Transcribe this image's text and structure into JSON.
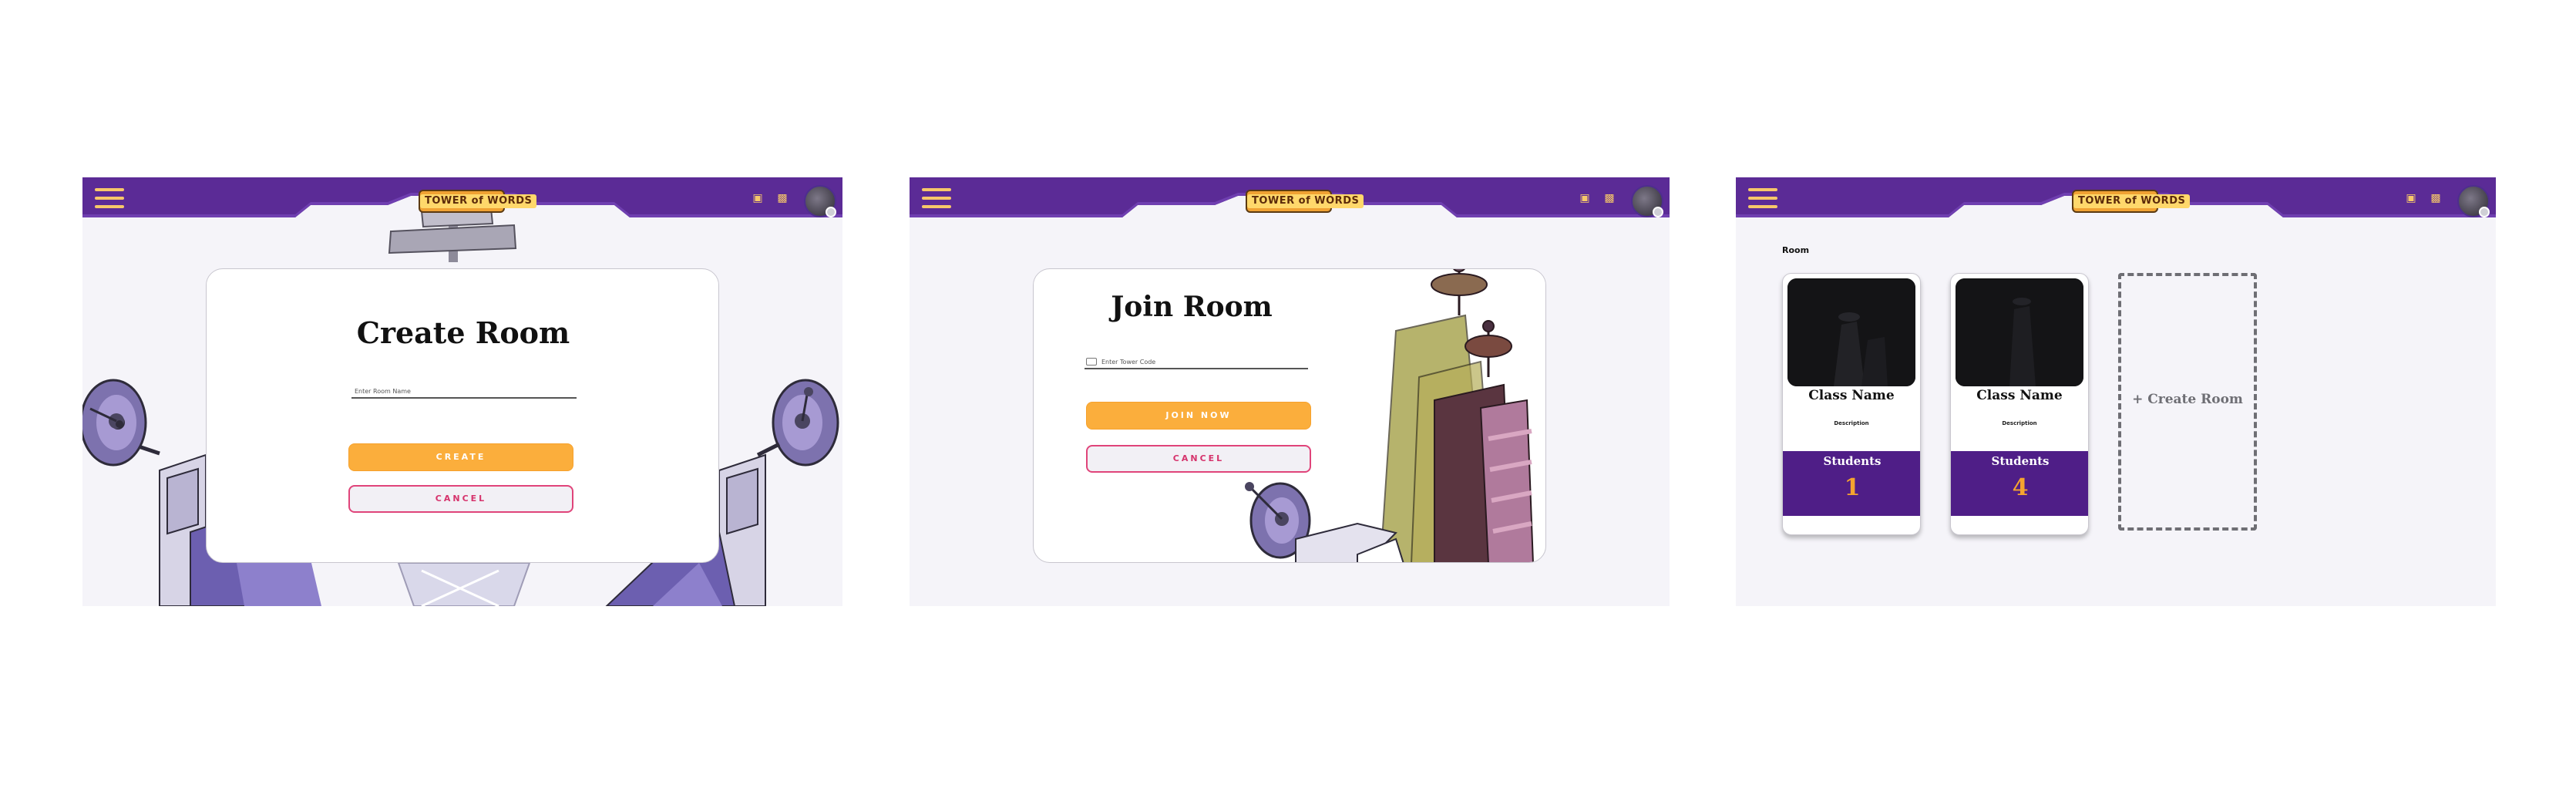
{
  "brand": {
    "logo_text": "TOWER of WORDS",
    "colors": {
      "topbar": "#5b2b96",
      "accent": "#fbae3c",
      "danger": "#e0447a",
      "stats": "#4f1e87",
      "count": "#f5a42f"
    }
  },
  "topbar": {
    "menu_icon": "hamburger-icon",
    "icons": [
      "store-icon",
      "treasure-chest-icon"
    ],
    "avatar": "profile-avatar"
  },
  "create_room": {
    "title": "Create Room",
    "name_placeholder": "Enter Room Name",
    "create_label": "CREATE",
    "cancel_label": "CANCEL"
  },
  "join_room": {
    "title": "Join Room",
    "code_placeholder": "Enter Tower Code",
    "code_icon": "keyboard-icon",
    "join_label": "JOIN NOW",
    "cancel_label": "CANCEL"
  },
  "rooms": {
    "section_label": "Room",
    "cards": [
      {
        "class_name": "Class Name",
        "description": "Description",
        "students_label": "Students",
        "students_count": "1"
      },
      {
        "class_name": "Class Name",
        "description": "Description",
        "students_label": "Students",
        "students_count": "4"
      }
    ],
    "create_room_label": "+ Create Room"
  }
}
